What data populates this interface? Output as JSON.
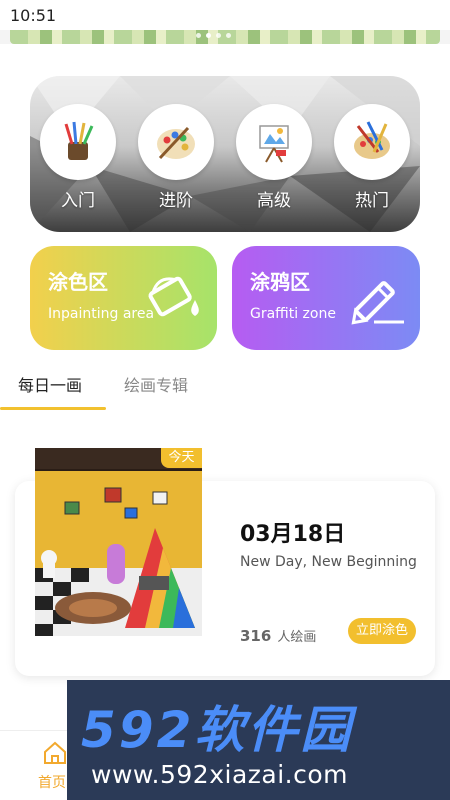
{
  "status_bar": {
    "time": "10:51"
  },
  "categories": [
    {
      "label": "入门",
      "icon": "brush-cup-icon"
    },
    {
      "label": "进阶",
      "icon": "palette-brush-icon"
    },
    {
      "label": "高级",
      "icon": "easel-icon"
    },
    {
      "label": "热门",
      "icon": "palette-brushes-icon"
    }
  ],
  "features": {
    "paint": {
      "title": "涂色区",
      "subtitle": "Inpainting area",
      "icon": "paint-bucket-icon"
    },
    "graffiti": {
      "title": "涂鸦区",
      "subtitle": "Graffiti zone",
      "icon": "pencil-icon"
    }
  },
  "tabs": [
    {
      "label": "每日一画",
      "active": true
    },
    {
      "label": "绘画专辑",
      "active": false
    }
  ],
  "daily": {
    "badge": "今天",
    "date": "03月18日",
    "title": "New Day, New Beginning",
    "count": "316",
    "count_unit": "人绘画",
    "button": "立即涂色"
  },
  "bottom_nav": {
    "home_label": "首页"
  },
  "watermark": {
    "logo": "592软件园",
    "url": "www.592xiazai.com"
  },
  "colors": {
    "accent": "#f2bf2e",
    "paint_gradient": [
      "#f2d04c",
      "#a6e36a"
    ],
    "graffiti_gradient": [
      "#b65cf2",
      "#7c8bf4"
    ]
  }
}
